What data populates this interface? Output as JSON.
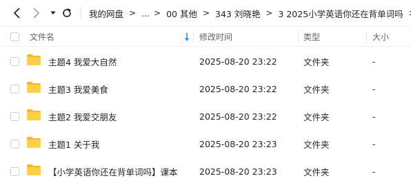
{
  "colors": {
    "accent": "#2b8cff",
    "folder_back": "#f5b924",
    "folder_front": "#ffd046"
  },
  "toolbar": {
    "back_icon": "chevron-left-icon",
    "forward_icon": "chevron-right-icon",
    "history_icon": "caret-down-icon",
    "refresh_icon": "refresh-icon"
  },
  "breadcrumb": {
    "items": [
      "我的网盘",
      "...",
      "00 其他",
      "343 刘晓艳",
      "3 2025小学英语你还在背单词吗"
    ],
    "separator": ">"
  },
  "table": {
    "columns": {
      "name": "文件名",
      "modified": "修改时间",
      "type": "类型",
      "size": "大小"
    },
    "sort_icon": "sort-down-arrow-icon",
    "rows": [
      {
        "name": "主题4 我爱大自然",
        "modified": "2025-08-20 23:22",
        "type": "文件夹",
        "size": "-"
      },
      {
        "name": "主题3  我爱美食",
        "modified": "2025-08-20 23:22",
        "type": "文件夹",
        "size": "-"
      },
      {
        "name": "主题2  我爱交朋友",
        "modified": "2025-08-20 23:22",
        "type": "文件夹",
        "size": "-"
      },
      {
        "name": "主题1 关于我",
        "modified": "2025-08-20 23:23",
        "type": "文件夹",
        "size": "-"
      },
      {
        "name": "【小学英语你还在背单词吗】课本",
        "modified": "2025-08-20 23:23",
        "type": "文件夹",
        "size": "-"
      }
    ]
  }
}
